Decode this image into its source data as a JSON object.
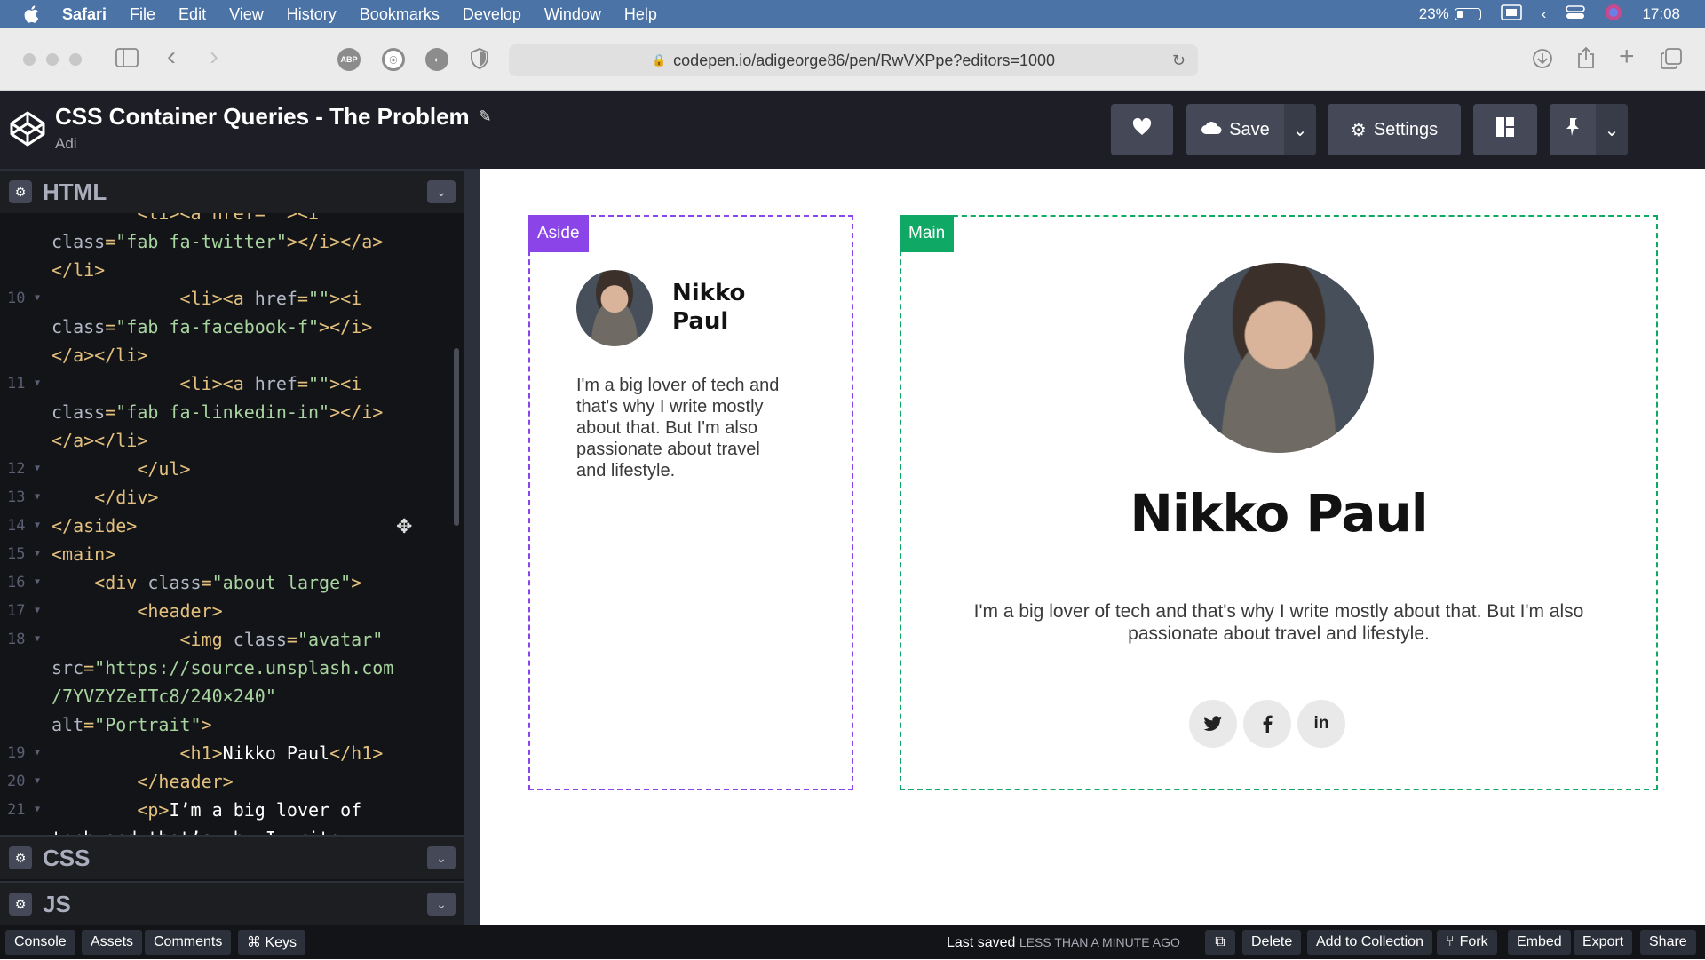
{
  "menubar": {
    "app": "Safari",
    "items": [
      "File",
      "Edit",
      "View",
      "History",
      "Bookmarks",
      "Develop",
      "Window",
      "Help"
    ],
    "battery": "23%",
    "battery_level": 0.23,
    "clock": "17:08"
  },
  "browser": {
    "url": "codepen.io/adigeorge86/pen/RwVXPpe?editors=1000",
    "extensions": [
      "ABP"
    ]
  },
  "header": {
    "title": "CSS Container Queries - The Problem",
    "author": "Adi",
    "save_label": "Save",
    "settings_label": "Settings"
  },
  "editor": {
    "panels": {
      "html": "HTML",
      "css": "CSS",
      "js": "JS"
    },
    "code_lines": [
      {
        "num": "",
        "parts": [
          [
            "tag",
            "        <li><a href=\"\"><i"
          ]
        ]
      },
      {
        "num": "",
        "parts": [
          [
            "attr",
            "class"
          ],
          [
            "tag",
            "="
          ],
          [
            "str",
            "\"fab fa-twitter\""
          ],
          [
            "tag",
            "></i></a>"
          ]
        ]
      },
      {
        "num": "",
        "parts": [
          [
            "tag",
            "</li>"
          ]
        ]
      },
      {
        "num": "10",
        "parts": [
          [
            "tag",
            "            <li><a "
          ],
          [
            "attr",
            "href"
          ],
          [
            "tag",
            "="
          ],
          [
            "str",
            "\"\""
          ],
          [
            "tag",
            "><i"
          ]
        ]
      },
      {
        "num": "",
        "parts": [
          [
            "attr",
            "class"
          ],
          [
            "tag",
            "="
          ],
          [
            "str",
            "\"fab fa-facebook-f\""
          ],
          [
            "tag",
            "></i>"
          ]
        ]
      },
      {
        "num": "",
        "parts": [
          [
            "tag",
            "</a></li>"
          ]
        ]
      },
      {
        "num": "11",
        "parts": [
          [
            "tag",
            "            <li><a "
          ],
          [
            "attr",
            "href"
          ],
          [
            "tag",
            "="
          ],
          [
            "str",
            "\"\""
          ],
          [
            "tag",
            "><i"
          ]
        ]
      },
      {
        "num": "",
        "parts": [
          [
            "attr",
            "class"
          ],
          [
            "tag",
            "="
          ],
          [
            "str",
            "\"fab fa-linkedin-in\""
          ],
          [
            "tag",
            "></i>"
          ]
        ]
      },
      {
        "num": "",
        "parts": [
          [
            "tag",
            "</a></li>"
          ]
        ]
      },
      {
        "num": "12",
        "parts": [
          [
            "tag",
            "        </ul>"
          ]
        ]
      },
      {
        "num": "13",
        "parts": [
          [
            "tag",
            "    </div>"
          ]
        ]
      },
      {
        "num": "14",
        "parts": [
          [
            "tag",
            "</aside>"
          ]
        ]
      },
      {
        "num": "15",
        "parts": [
          [
            "tag",
            "<main>"
          ]
        ]
      },
      {
        "num": "16",
        "parts": [
          [
            "tag",
            "    <div "
          ],
          [
            "attr",
            "class"
          ],
          [
            "tag",
            "="
          ],
          [
            "str",
            "\"about large\""
          ],
          [
            "tag",
            ">"
          ]
        ]
      },
      {
        "num": "17",
        "parts": [
          [
            "tag",
            "        <header>"
          ]
        ]
      },
      {
        "num": "18",
        "parts": [
          [
            "tag",
            "            <img "
          ],
          [
            "attr",
            "class"
          ],
          [
            "tag",
            "="
          ],
          [
            "str",
            "\"avatar\""
          ]
        ]
      },
      {
        "num": "",
        "parts": [
          [
            "attr",
            "src"
          ],
          [
            "tag",
            "="
          ],
          [
            "str",
            "\"https://source.unsplash.com"
          ]
        ]
      },
      {
        "num": "",
        "parts": [
          [
            "str",
            "/7YVZYZeITc8/240×240\""
          ]
        ]
      },
      {
        "num": "",
        "parts": [
          [
            "attr",
            "alt"
          ],
          [
            "tag",
            "="
          ],
          [
            "str",
            "\"Portrait\""
          ],
          [
            "tag",
            ">"
          ]
        ]
      },
      {
        "num": "19",
        "parts": [
          [
            "tag",
            "            <h1>"
          ],
          [
            "txt",
            "Nikko Paul"
          ],
          [
            "tag",
            "</h1>"
          ]
        ]
      },
      {
        "num": "20",
        "parts": [
          [
            "tag",
            "        </header>"
          ]
        ]
      },
      {
        "num": "21",
        "parts": [
          [
            "tag",
            "        <p>"
          ],
          [
            "txt",
            "I’m a big lover of"
          ]
        ]
      },
      {
        "num": "",
        "parts": [
          [
            "txt",
            "tech and that’s why I write"
          ]
        ]
      }
    ]
  },
  "preview": {
    "aside_label": "Aside",
    "main_label": "Main",
    "aside_color": "#8b44e8",
    "main_color": "#0fa864",
    "name": "Nikko Paul",
    "name_line1": "Nikko",
    "name_line2": "Paul",
    "bio_lines_small": [
      "I'm a big lover of tech and",
      "that's why I write mostly",
      "about that. But I'm also",
      "passionate about travel",
      "and lifestyle."
    ],
    "bio_lines_large": [
      "I'm a big lover of tech and that's why I write mostly about that. But I'm also",
      "passionate about travel and lifestyle."
    ],
    "socials": [
      "twitter-icon",
      "facebook-icon",
      "linkedin-icon"
    ]
  },
  "footer": {
    "console": "Console",
    "assets": "Assets",
    "comments": "Comments",
    "keys": "⌘ Keys",
    "last_saved": "Last saved",
    "last_saved_time": "LESS THAN A MINUTE AGO",
    "delete": "Delete",
    "add_collection": "Add to Collection",
    "fork": "Fork",
    "embed": "Embed",
    "export": "Export",
    "share": "Share"
  }
}
